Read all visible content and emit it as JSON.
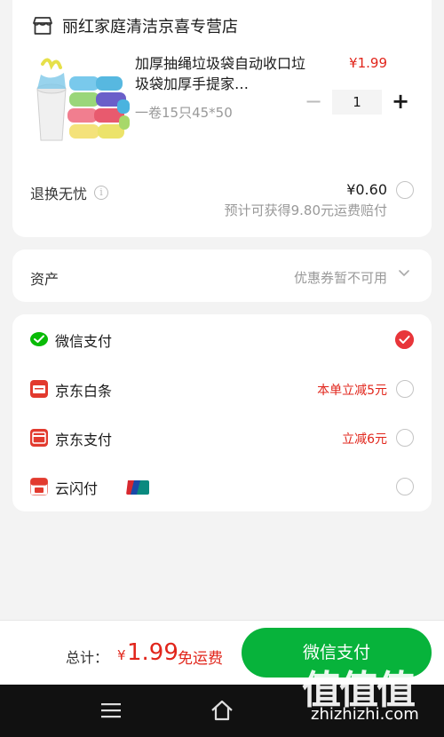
{
  "shop": {
    "name": "丽红家庭清洁京喜专营店",
    "product": {
      "title": "加厚抽绳垃圾袋自动收口垃圾袋加厚手提家…",
      "spec": "一卷15只45*50",
      "price": "¥1.99",
      "quantity": "1",
      "minus": "−",
      "plus": "+"
    },
    "return_service": {
      "label": "退换无忧",
      "info": "i",
      "price": "¥0.60",
      "note": "预计可获得9.80元运费赔付"
    }
  },
  "assets": {
    "label": "资产",
    "value": "优惠券暂不可用"
  },
  "payment": {
    "methods": [
      {
        "label": "微信支付",
        "promo": "",
        "selected": true,
        "icon": "wechat-pay-icon"
      },
      {
        "label": "京东白条",
        "promo": "本单立减5元",
        "selected": false,
        "icon": "jd-baitiao-icon"
      },
      {
        "label": "京东支付",
        "promo": "立减6元",
        "selected": false,
        "icon": "jd-pay-icon"
      },
      {
        "label": "云闪付",
        "promo": "",
        "selected": false,
        "icon": "quickpass-icon",
        "badge": "unionpay-icon"
      }
    ]
  },
  "bottom": {
    "total_label": "总计：",
    "currency": "¥",
    "amount": "1.99",
    "shipping": "免运费",
    "pay_button": "微信支付"
  },
  "watermark": {
    "glyphs": "值值值",
    "text": "zhizhizhi.com"
  },
  "colors": {
    "accent_red": "#e1251b",
    "pay_green": "#07b33b",
    "background": "#f3f3f3"
  }
}
